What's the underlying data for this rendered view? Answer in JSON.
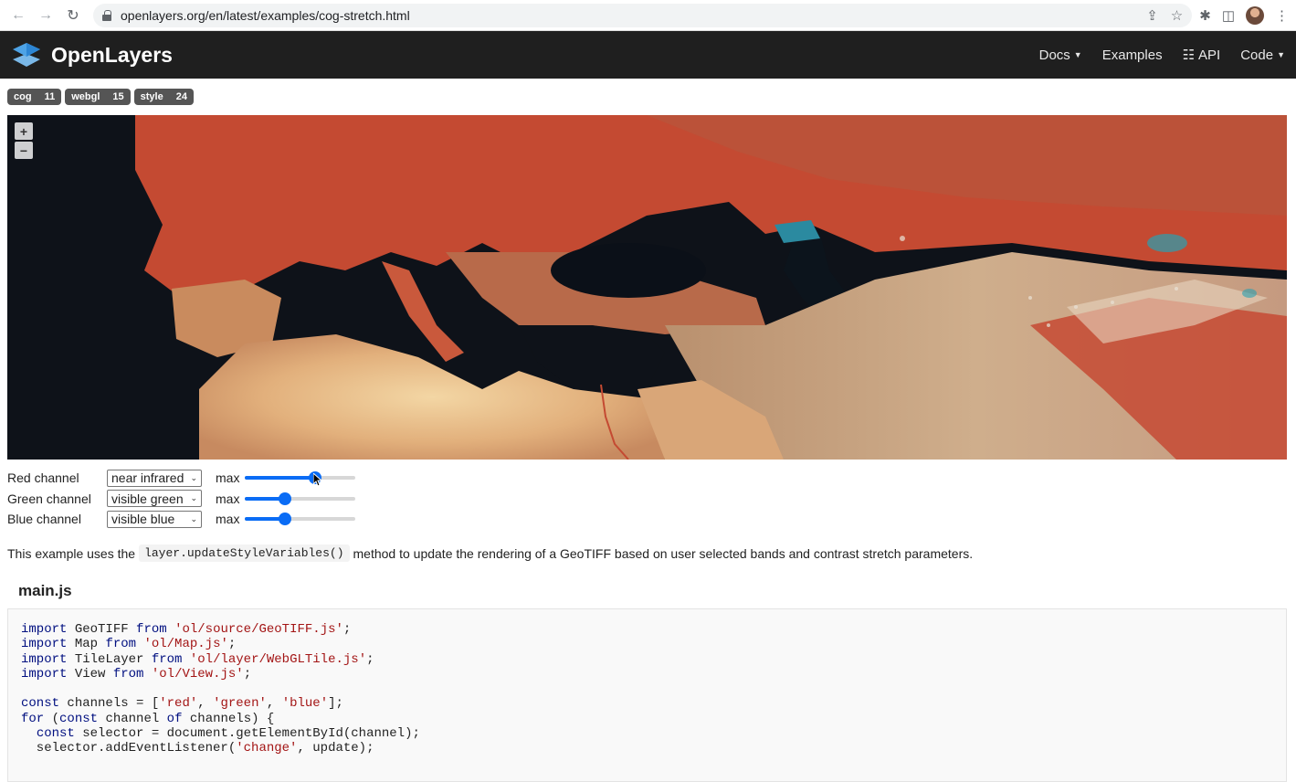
{
  "browser": {
    "url": "openlayers.org/en/latest/examples/cog-stretch.html"
  },
  "header": {
    "brand": "OpenLayers",
    "nav": [
      "Docs",
      "Examples",
      "API",
      "Code"
    ]
  },
  "tags": [
    {
      "label": "cog",
      "count": "11"
    },
    {
      "label": "webgl",
      "count": "15"
    },
    {
      "label": "style",
      "count": "24"
    }
  ],
  "map": {
    "zoom_in": "+",
    "zoom_out": "−"
  },
  "controls": [
    {
      "label": "Red channel",
      "value": "near infrared",
      "max_label": "max",
      "slider_fraction": 0.65
    },
    {
      "label": "Green channel",
      "value": "visible green",
      "max_label": "max",
      "slider_fraction": 0.35
    },
    {
      "label": "Blue channel",
      "value": "visible blue",
      "max_label": "max",
      "slider_fraction": 0.35
    }
  ],
  "description": {
    "before": "This example uses the",
    "code": "layer.updateStyleVariables()",
    "after": "method to update the rendering of a GeoTIFF based on user selected bands and contrast stretch parameters."
  },
  "code_section": {
    "filename": "main.js",
    "lines": [
      [
        [
          "kw",
          "import"
        ],
        [
          "",
          " GeoTIFF "
        ],
        [
          "kw",
          "from"
        ],
        [
          "",
          " "
        ],
        [
          "str",
          "'ol/source/GeoTIFF.js'"
        ],
        [
          "",
          ";"
        ]
      ],
      [
        [
          "kw",
          "import"
        ],
        [
          "",
          " Map "
        ],
        [
          "kw",
          "from"
        ],
        [
          "",
          " "
        ],
        [
          "str",
          "'ol/Map.js'"
        ],
        [
          "",
          ";"
        ]
      ],
      [
        [
          "kw",
          "import"
        ],
        [
          "",
          " TileLayer "
        ],
        [
          "kw",
          "from"
        ],
        [
          "",
          " "
        ],
        [
          "str",
          "'ol/layer/WebGLTile.js'"
        ],
        [
          "",
          ";"
        ]
      ],
      [
        [
          "kw",
          "import"
        ],
        [
          "",
          " View "
        ],
        [
          "kw",
          "from"
        ],
        [
          "",
          " "
        ],
        [
          "str",
          "'ol/View.js'"
        ],
        [
          "",
          ";"
        ]
      ],
      [
        [
          "",
          ""
        ]
      ],
      [
        [
          "kw",
          "const"
        ],
        [
          "",
          " channels = ["
        ],
        [
          "str",
          "'red'"
        ],
        [
          "",
          ", "
        ],
        [
          "str",
          "'green'"
        ],
        [
          "",
          ", "
        ],
        [
          "str",
          "'blue'"
        ],
        [
          "",
          "];"
        ]
      ],
      [
        [
          "kw",
          "for"
        ],
        [
          "",
          " ("
        ],
        [
          "kw",
          "const"
        ],
        [
          "",
          " channel "
        ],
        [
          "kw",
          "of"
        ],
        [
          "",
          " channels) {"
        ]
      ],
      [
        [
          "",
          "  "
        ],
        [
          "kw",
          "const"
        ],
        [
          "",
          " selector = document.getElementById(channel);"
        ]
      ],
      [
        [
          "",
          "  selector.addEventListener("
        ],
        [
          "str",
          "'change'"
        ],
        [
          "",
          ", update);"
        ]
      ]
    ]
  }
}
